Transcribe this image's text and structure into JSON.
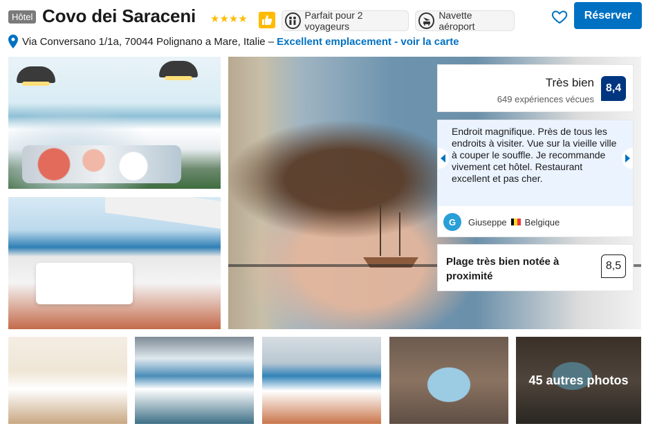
{
  "header": {
    "type_badge": "Hôtel",
    "hotel_name": "Covo dei Saraceni",
    "stars": 4,
    "stars_text": "★★★★",
    "preferred_icon": "thumbs-up-icon",
    "chips": {
      "travelers": "Parfait pour 2 voyageurs",
      "shuttle": "Navette aéroport"
    },
    "reserve_label": "Réserver",
    "address": "Via Conversano 1/1a, 70044 Polignano a Mare, Italie –",
    "location_link": "Excellent emplacement - voir la carte"
  },
  "score": {
    "label": "Très bien",
    "subtext": "649 expériences vécues",
    "value": "8,4"
  },
  "review": {
    "text": "Endroit magnifique. Près de tous les endroits à visiter. Vue sur la vieille ville à couper le souffle. Je recommande vivement cet hôtel. Restaurant excellent et pas cher.",
    "avatar_letter": "G",
    "reviewer": "Giuseppe",
    "country": "Belgique"
  },
  "beach": {
    "label": "Plage très bien notée à proximité",
    "score": "8,5"
  },
  "gallery": {
    "more_label": "45 autres photos"
  },
  "colors": {
    "primary_blue": "#0071c2",
    "score_navy": "#003580",
    "star_yellow": "#febb02",
    "review_bg": "#ebf3ff"
  }
}
